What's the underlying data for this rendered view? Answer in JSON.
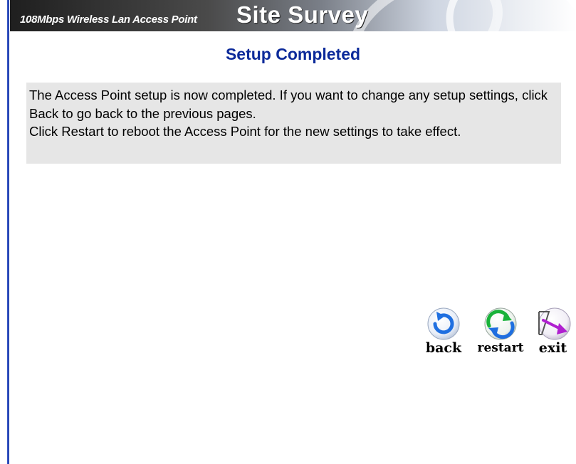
{
  "banner": {
    "subtitle": "108Mbps Wireless Lan Access Point",
    "title": "Site Survey"
  },
  "heading": "Setup Completed",
  "message": {
    "line1": "The Access Point setup is now completed. If you want to change any setup settings, click Back to go back to the previous pages.",
    "line2": "Click Restart to reboot the Access Point for the new settings to take effect."
  },
  "buttons": {
    "back": "back",
    "restart": "restart",
    "exit": "exit"
  },
  "icons": {
    "back": "back-arrow-icon",
    "restart": "restart-cycle-icon",
    "exit": "exit-door-icon"
  },
  "colors": {
    "heading": "#0c2a9a",
    "message_bg": "#e6e6e6",
    "accent_blue": "#1f6fe0",
    "restart_green": "#19b23a",
    "exit_purple": "#b020d0"
  }
}
